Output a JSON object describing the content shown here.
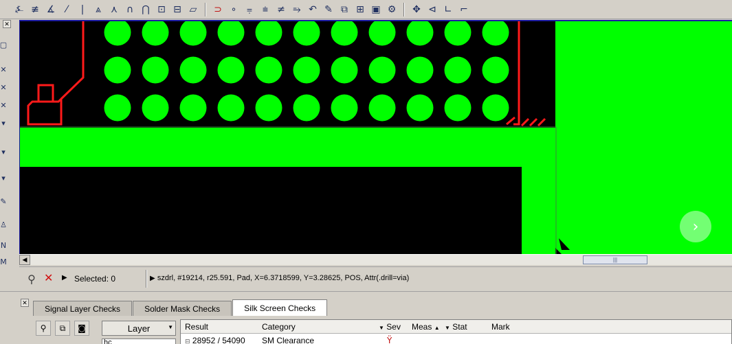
{
  "toolbar": {
    "icons": [
      "probe-icon",
      "route-icon",
      "angle-icon",
      "diagonal-icon",
      "bar-icon",
      "triangle-icon",
      "fork-icon",
      "arch-a-icon",
      "arch-b-icon",
      "box-up-icon",
      "box-flag-icon",
      "italic-box-icon",
      "magnet-icon",
      "via-small-icon",
      "slide-a-icon",
      "slide-b-icon",
      "slide-c-icon",
      "slide-d-icon",
      "curve-icon",
      "pen-icon",
      "clip-icon",
      "add-box-icon",
      "edit-box-icon",
      "dragon-icon",
      "move-icon",
      "shape-a-icon",
      "shape-b-icon",
      "shape-c-icon"
    ]
  },
  "canvas": {
    "colors": {
      "copper": "#00ff00",
      "silk": "#ff1a1a",
      "background": "#000000"
    }
  },
  "status": {
    "selected": "Selected: 0",
    "info": "szdrl, #19214, r25.591, Pad, X=6.3718599, Y=3.28625, POS, Attr(.drill=via)"
  },
  "tabs": [
    {
      "label": "Signal Layer Checks",
      "active": false
    },
    {
      "label": "Solder Mask Checks",
      "active": false
    },
    {
      "label": "Silk Screen Checks",
      "active": true
    }
  ],
  "bottom": {
    "layer_label": "Layer",
    "layer_input": "hc",
    "columns": [
      "Result",
      "Category",
      "Sev",
      "Meas",
      "Stat",
      "Mark"
    ],
    "rows": [
      {
        "result": "28952 / 54090",
        "category": "SM Clearance",
        "sev": ""
      }
    ]
  }
}
